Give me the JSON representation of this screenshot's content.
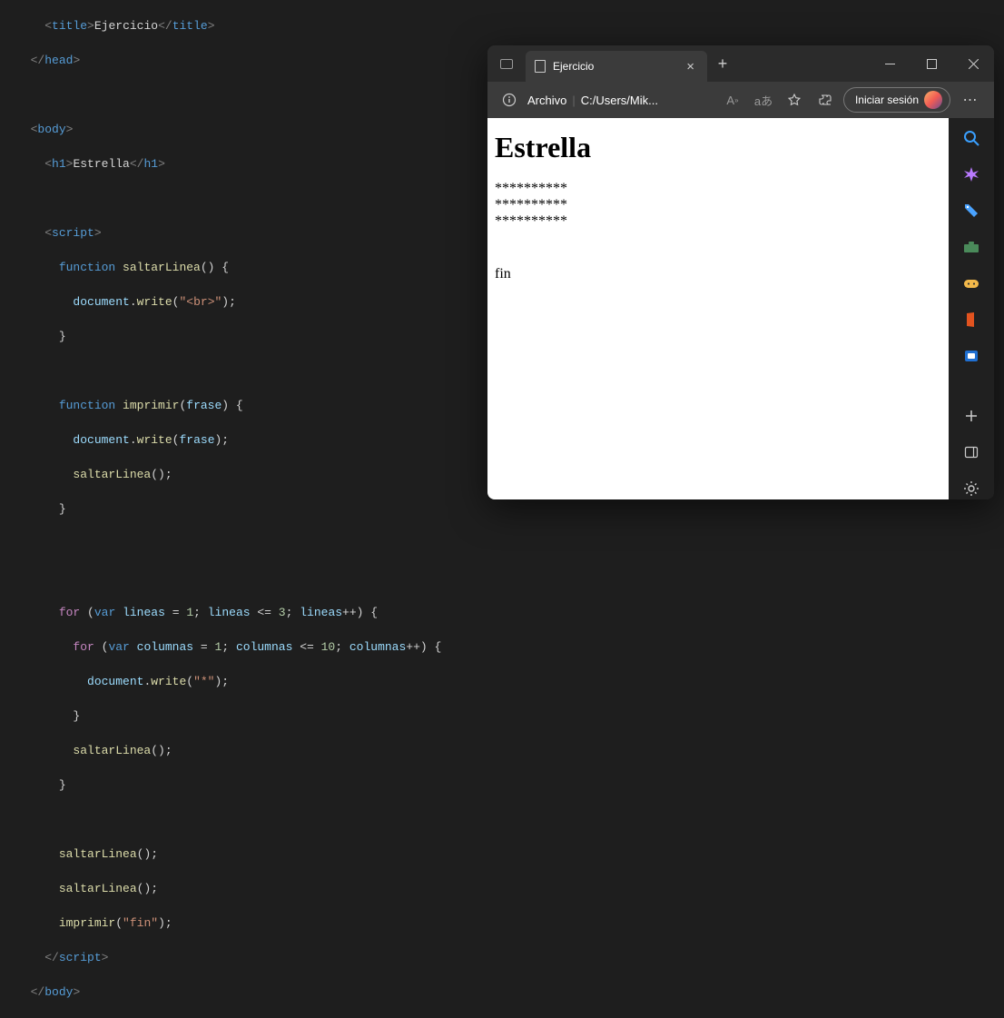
{
  "editor": {
    "title": "Ejercicio",
    "head_close": "head",
    "body_open": "body",
    "h1_tag": "h1",
    "h1_text": "Estrella",
    "script_tag": "script",
    "kw_function": "function",
    "fn_saltarLinea": "saltarLinea",
    "fn_imprimir": "imprimir",
    "param_frase": "frase",
    "obj_document": "document",
    "fn_write": "write",
    "str_br": "\"<br>\"",
    "str_star": "\"*\"",
    "str_fin": "\"fin\"",
    "kw_for": "for",
    "kw_var": "var",
    "var_lineas": "lineas",
    "var_columnas": "columnas",
    "num_1": "1",
    "num_3": "3",
    "num_10": "10",
    "body_close": "body",
    "title_tag": "title"
  },
  "browser": {
    "tab_title": "Ejercicio",
    "url_label": "Archivo",
    "url_path": "C:/Users/Mik...",
    "signin": "Iniciar sesión"
  },
  "page": {
    "heading": "Estrella",
    "stars_row": "**********",
    "fin": "fin"
  },
  "chart_data": {
    "type": "table",
    "title": "Rendered page output",
    "rows": [
      "**********",
      "**********",
      "**********",
      "",
      "",
      "fin"
    ]
  }
}
